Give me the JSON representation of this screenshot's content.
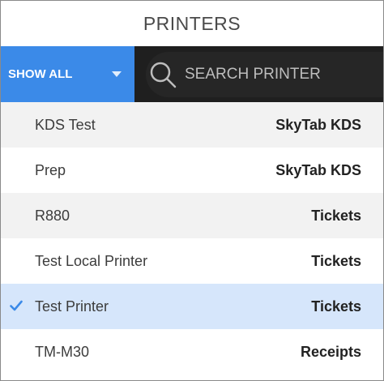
{
  "title": "PRINTERS",
  "filter": {
    "label": "SHOW ALL"
  },
  "search": {
    "placeholder": "SEARCH PRINTER"
  },
  "colors": {
    "accent": "#3b8ae8",
    "selected_row": "#d6e6fb",
    "check": "#3b8ae8"
  },
  "printers": [
    {
      "name": "KDS Test",
      "type": "SkyTab KDS",
      "selected": false
    },
    {
      "name": "Prep",
      "type": "SkyTab KDS",
      "selected": false
    },
    {
      "name": "R880",
      "type": "Tickets",
      "selected": false
    },
    {
      "name": "Test Local Printer",
      "type": "Tickets",
      "selected": false
    },
    {
      "name": "Test Printer",
      "type": "Tickets",
      "selected": true
    },
    {
      "name": "TM-M30",
      "type": "Receipts",
      "selected": false
    }
  ]
}
